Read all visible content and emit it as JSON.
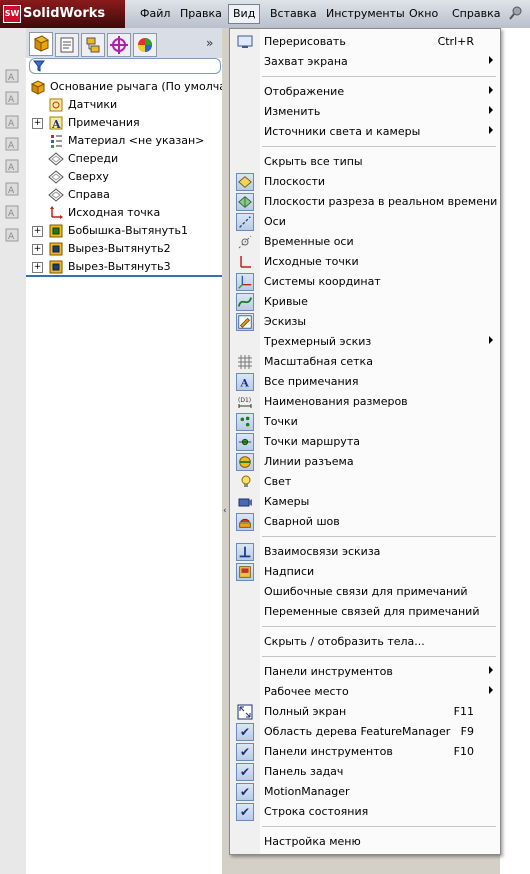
{
  "app": {
    "logo_text": "SolidWorks",
    "logo_badge": "SW"
  },
  "menubar": {
    "items": [
      "Файл",
      "Правка",
      "Вид",
      "Вставка",
      "Инструменты",
      "Окно",
      "Справка"
    ],
    "active": "Вид"
  },
  "feature_tree": {
    "items": [
      {
        "label": "Основание рычага  (По умолчанию",
        "icon": "part-icon",
        "expandable": false
      },
      {
        "label": "Датчики",
        "icon": "sensors-icon",
        "expandable": false
      },
      {
        "label": "Примечания",
        "icon": "annotations-icon",
        "expandable": true
      },
      {
        "label": "Материал <не указан>",
        "icon": "material-icon",
        "expandable": false
      },
      {
        "label": "Спереди",
        "icon": "plane-icon",
        "expandable": false
      },
      {
        "label": "Сверху",
        "icon": "plane-icon",
        "expandable": false
      },
      {
        "label": "Справа",
        "icon": "plane-icon",
        "expandable": false
      },
      {
        "label": "Исходная точка",
        "icon": "origin-icon",
        "expandable": false
      },
      {
        "label": "Бобышка-Вытянуть1",
        "icon": "extrude-icon",
        "expandable": true
      },
      {
        "label": "Вырез-Вытянуть2",
        "icon": "cut-extrude-icon",
        "expandable": true
      },
      {
        "label": "Вырез-Вытянуть3",
        "icon": "cut-extrude-icon",
        "expandable": true
      }
    ]
  },
  "view_menu": {
    "items": [
      {
        "label": "Перерисовать",
        "shortcut": "Ctrl+R",
        "icon": "redraw-icon"
      },
      {
        "label": "Захват экрана",
        "submenu": true
      },
      {
        "separator": true
      },
      {
        "label": "Отображение",
        "submenu": true
      },
      {
        "label": "Изменить",
        "submenu": true
      },
      {
        "label": "Источники света и камеры",
        "submenu": true
      },
      {
        "separator": true
      },
      {
        "label": "Скрыть все типы"
      },
      {
        "label": "Плоскости",
        "icon": "planes-icon",
        "boxed": true
      },
      {
        "label": "Плоскости разреза в реальном времени",
        "icon": "live-section-planes-icon",
        "boxed": true
      },
      {
        "label": "Оси",
        "icon": "axes-icon",
        "boxed": true
      },
      {
        "label": "Временные оси",
        "icon": "temporary-axes-icon"
      },
      {
        "label": "Исходные точки",
        "icon": "origins-icon"
      },
      {
        "label": "Системы координат",
        "icon": "coordinate-systems-icon",
        "boxed": true
      },
      {
        "label": "Кривые",
        "icon": "curves-icon",
        "boxed": true
      },
      {
        "label": "Эскизы",
        "icon": "sketches-icon",
        "boxed": true
      },
      {
        "label": "Трехмерный эскиз",
        "submenu": true
      },
      {
        "label": "Масштабная сетка",
        "icon": "grid-icon"
      },
      {
        "label": "Все примечания",
        "icon": "all-annotations-icon",
        "boxed": true
      },
      {
        "label": "Наименования размеров",
        "icon": "dimension-names-icon"
      },
      {
        "label": "Точки",
        "icon": "points-icon",
        "boxed": true
      },
      {
        "label": "Точки маршрута",
        "icon": "route-points-icon",
        "boxed": true
      },
      {
        "label": "Линии разъема",
        "icon": "parting-lines-icon",
        "boxed": true
      },
      {
        "label": "Свет",
        "icon": "lights-icon"
      },
      {
        "label": "Камеры",
        "icon": "cameras-icon"
      },
      {
        "label": "Сварной шов",
        "icon": "weld-bead-icon",
        "boxed": true
      },
      {
        "separator": true
      },
      {
        "label": "Взаимосвязи эскиза",
        "icon": "sketch-relations-icon",
        "boxed": true
      },
      {
        "label": "Надписи",
        "icon": "decals-icon",
        "boxed": true
      },
      {
        "label": "Ошибочные связи для примечаний"
      },
      {
        "label": "Переменные связей для примечаний"
      },
      {
        "separator": true
      },
      {
        "label": "Скрыть / отобразить тела..."
      },
      {
        "separator": true
      },
      {
        "label": "Панели инструментов",
        "submenu": true
      },
      {
        "label": "Рабочее место",
        "submenu": true
      },
      {
        "label": "Полный экран",
        "shortcut": "F11",
        "icon": "fullscreen-icon"
      },
      {
        "label": "Область дерева FeatureManager",
        "shortcut": "F9",
        "check": true
      },
      {
        "label": "Панели инструментов",
        "shortcut": "F10",
        "check": true
      },
      {
        "label": "Панель задач",
        "check": true
      },
      {
        "label": "MotionManager",
        "check": true
      },
      {
        "label": "Строка состояния",
        "check": true
      },
      {
        "separator": true
      },
      {
        "label": "Настройка меню"
      }
    ]
  },
  "colors": {
    "accent": "#356eb4",
    "menu_highlight": "#eef1f6",
    "logo_bg": "#6b1414"
  }
}
